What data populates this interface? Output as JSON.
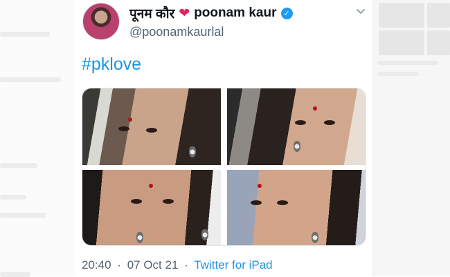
{
  "tweet": {
    "display_name_hindi": "पूनम कौर",
    "display_name": "poonam kaur",
    "handle": "@poonamkaurlal",
    "text": "#pklove",
    "time": "20:40",
    "date": "07 Oct 21",
    "separator": "·",
    "source": "Twitter for iPad",
    "media_count": 4
  },
  "icons": {
    "heart": "red-heart-icon",
    "verified": "verified-badge-icon",
    "more": "chevron-down-icon"
  },
  "colors": {
    "link": "#1b95e0",
    "verified": "#1d9bf0",
    "heart": "#e0245e",
    "secondary_text": "#536471"
  }
}
